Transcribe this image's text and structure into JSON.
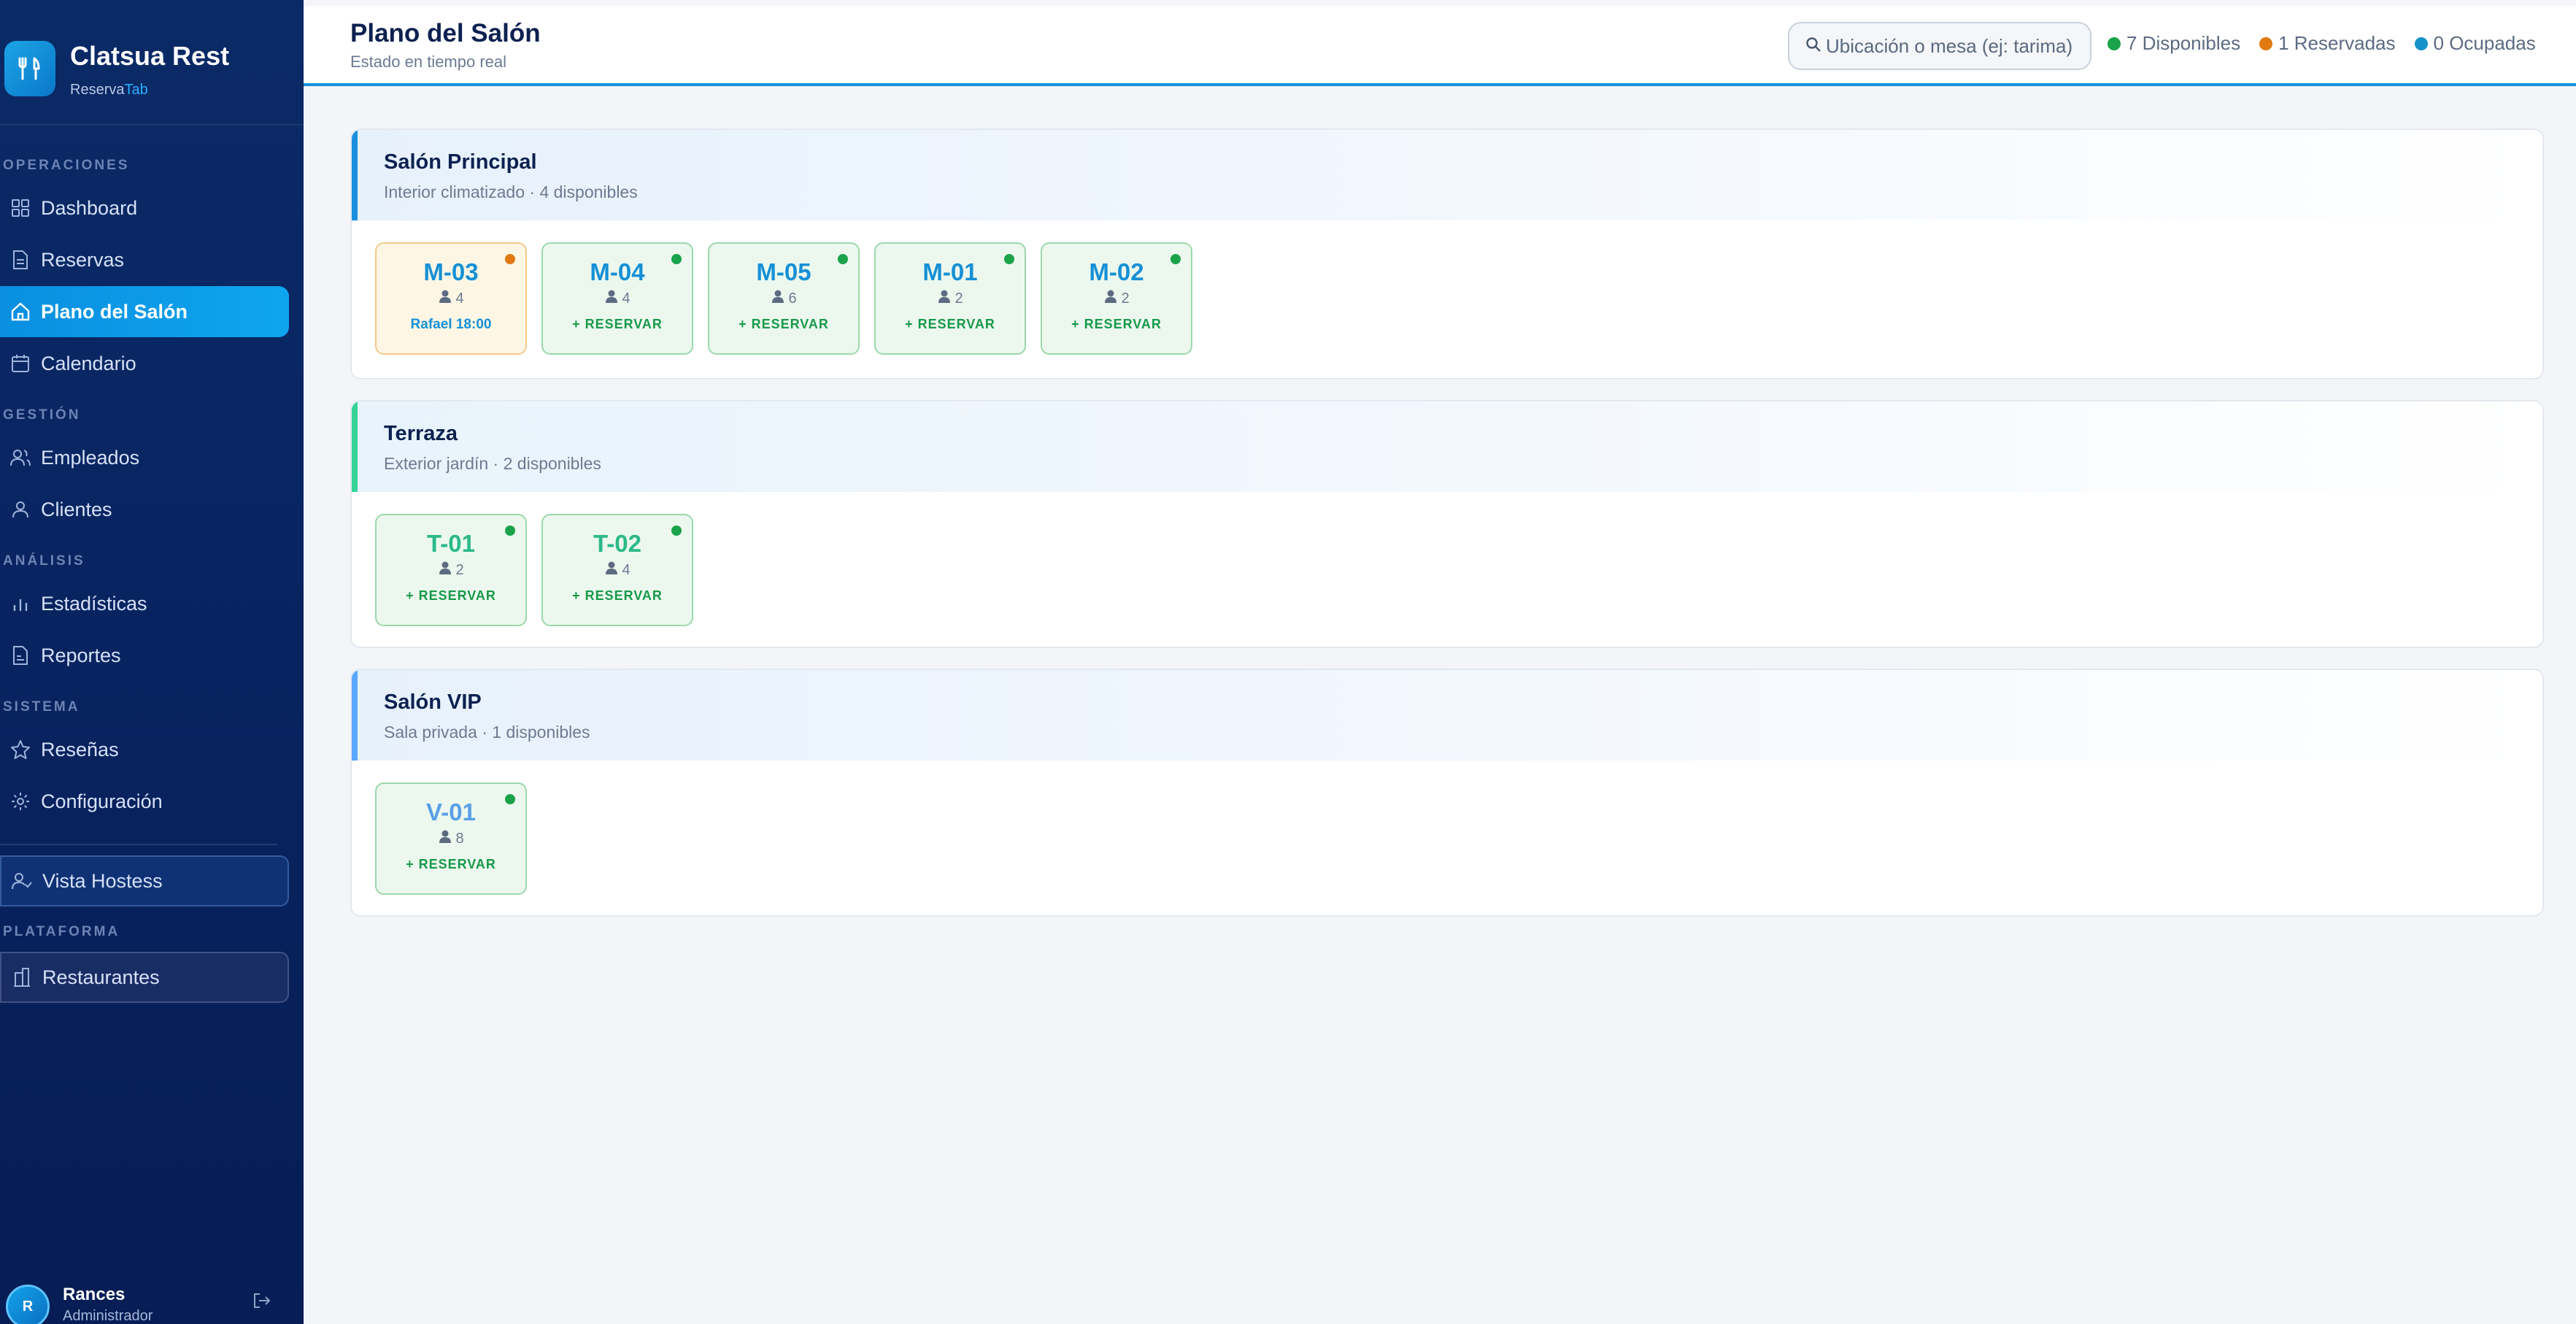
{
  "app": {
    "name": "Clatsua Rest",
    "sub_prefix": "Reserva",
    "sub_accent": "Tab"
  },
  "nav": {
    "sections": {
      "operaciones": "OPERACIONES",
      "gestion": "GESTIÓN",
      "analisis": "ANÁLISIS",
      "sistema": "SISTEMA",
      "plataforma": "PLATAFORMA"
    },
    "items": {
      "dashboard": "Dashboard",
      "reservas": "Reservas",
      "plano": "Plano del Salón",
      "calendario": "Calendario",
      "empleados": "Empleados",
      "clientes": "Clientes",
      "estadisticas": "Estadísticas",
      "reportes": "Reportes",
      "resenas": "Reseñas",
      "configuracion": "Configuración",
      "hostess": "Vista Hostess",
      "restaurantes": "Restaurantes"
    },
    "active": "plano"
  },
  "user": {
    "initial": "R",
    "name": "Rances",
    "role": "Administrador"
  },
  "header": {
    "title": "Plano del Salón",
    "subtitle": "Estado en tiempo real",
    "search_placeholder": "Ubicación o mesa (ej: tarima)",
    "stats": {
      "disponibles": "7 Disponibles",
      "reservadas": "1 Reservadas",
      "ocupadas": "0 Ocupadas"
    }
  },
  "colors": {
    "available": "#1aa34a",
    "reserved": "#e07a10",
    "occupied": "#1592c8",
    "accent": "#0ea5ee"
  },
  "zones": [
    {
      "name": "Salón Principal",
      "desc": "Interior climatizado · 4 disponibles",
      "tables": [
        {
          "id": "M-03",
          "capacity": "4",
          "status": "reserved",
          "action": "Rafael 18:00"
        },
        {
          "id": "M-04",
          "capacity": "4",
          "status": "available",
          "action": "+ RESERVAR"
        },
        {
          "id": "M-05",
          "capacity": "6",
          "status": "available",
          "action": "+ RESERVAR"
        },
        {
          "id": "M-01",
          "capacity": "2",
          "status": "available",
          "action": "+ RESERVAR"
        },
        {
          "id": "M-02",
          "capacity": "2",
          "status": "available",
          "action": "+ RESERVAR"
        }
      ]
    },
    {
      "name": "Terraza",
      "desc": "Exterior jardín · 2 disponibles",
      "tables": [
        {
          "id": "T-01",
          "capacity": "2",
          "status": "available",
          "action": "+ RESERVAR"
        },
        {
          "id": "T-02",
          "capacity": "4",
          "status": "available",
          "action": "+ RESERVAR"
        }
      ]
    },
    {
      "name": "Salón VIP",
      "desc": "Sala privada · 1 disponibles",
      "tables": [
        {
          "id": "V-01",
          "capacity": "8",
          "status": "available",
          "action": "+ RESERVAR"
        }
      ]
    }
  ]
}
